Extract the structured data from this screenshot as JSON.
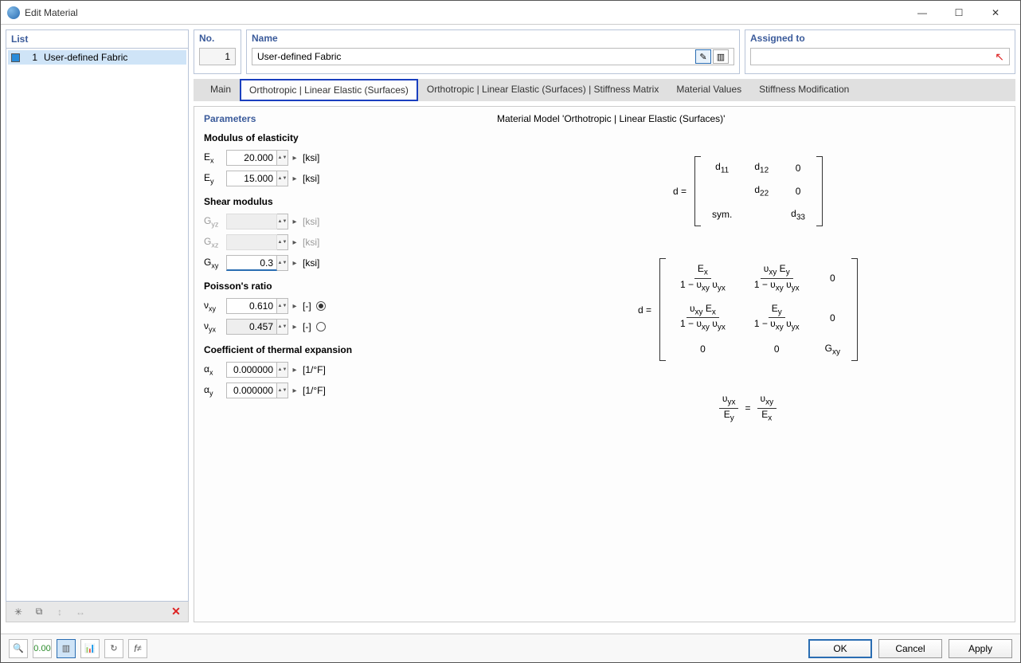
{
  "window": {
    "title": "Edit Material"
  },
  "list": {
    "header": "List",
    "items": [
      {
        "num": "1",
        "label": "User-defined Fabric"
      }
    ]
  },
  "fields": {
    "no_label": "No.",
    "no_value": "1",
    "name_label": "Name",
    "name_value": "User-defined Fabric",
    "assigned_label": "Assigned to",
    "assigned_value": ""
  },
  "tabs": [
    "Main",
    "Orthotropic | Linear Elastic (Surfaces)",
    "Orthotropic | Linear Elastic (Surfaces) | Stiffness Matrix",
    "Material Values",
    "Stiffness Modification"
  ],
  "params": {
    "title": "Parameters",
    "modulus_heading": "Modulus of elasticity",
    "Ex_label": "Eₓ",
    "Ex_value": "20.000",
    "Ex_unit": "[ksi]",
    "Ey_label": "Eᵧ",
    "Ey_value": "15.000",
    "Ey_unit": "[ksi]",
    "shear_heading": "Shear modulus",
    "Gyz_label": "Gᵧ₂",
    "Gyz_value": "",
    "Gyz_unit": "[ksi]",
    "Gxz_label": "Gₓ₂",
    "Gxz_value": "",
    "Gxz_unit": "[ksi]",
    "Gxy_label": "Gₓᵧ",
    "Gxy_value": "0.3",
    "Gxy_unit": "[ksi]",
    "poisson_heading": "Poisson's ratio",
    "vxy_label": "νₓᵧ",
    "vxy_value": "0.610",
    "vxy_unit": "[-]",
    "vyx_label": "νᵧₓ",
    "vyx_value": "0.457",
    "vyx_unit": "[-]",
    "thermal_heading": "Coefficient of thermal expansion",
    "ax_label": "αₓ",
    "ax_value": "0.000000",
    "ax_unit": "[1/°F]",
    "ay_label": "αᵧ",
    "ay_value": "0.000000",
    "ay_unit": "[1/°F]"
  },
  "model": {
    "title": "Material Model 'Orthotropic | Linear Elastic (Surfaces)'"
  },
  "buttons": {
    "ok": "OK",
    "cancel": "Cancel",
    "apply": "Apply"
  }
}
